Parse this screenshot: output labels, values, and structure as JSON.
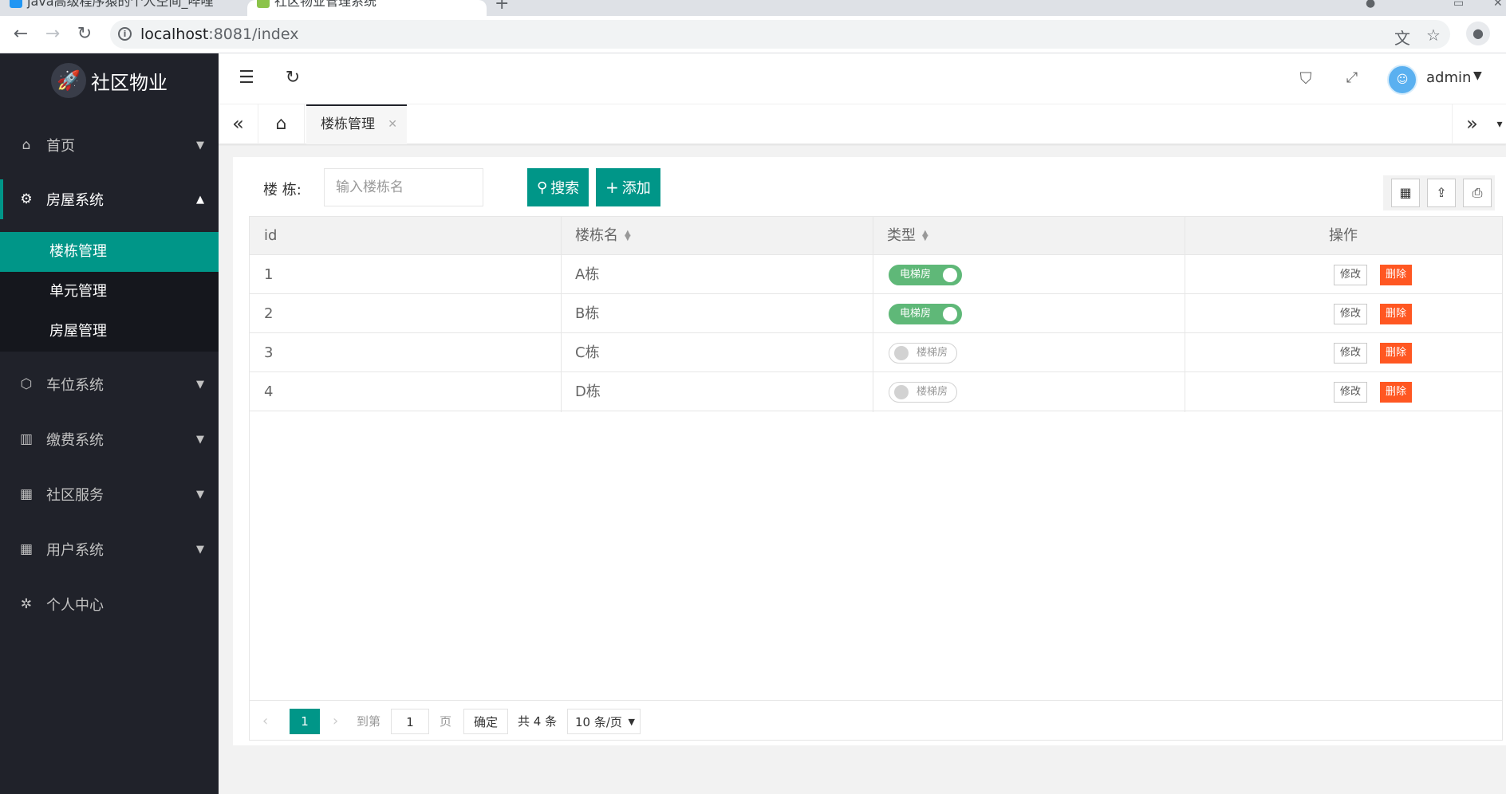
{
  "browser": {
    "tabs": [
      {
        "title": "java高级程序猿的个人空间_哔哩"
      },
      {
        "title": "社区物业管理系统"
      }
    ],
    "url_host": "localhost",
    "url_path": ":8081/index"
  },
  "sidebar": {
    "logo_text": "社区物业",
    "items": [
      {
        "label": "首页",
        "icon": "home-icon"
      },
      {
        "label": "房屋系统",
        "icon": "gear-icon"
      },
      {
        "label": "车位系统",
        "icon": "cube-icon"
      },
      {
        "label": "缴费系统",
        "icon": "building-icon"
      },
      {
        "label": "社区服务",
        "icon": "grid-icon"
      },
      {
        "label": "用户系统",
        "icon": "grid-icon"
      },
      {
        "label": "个人中心",
        "icon": "settings-icon"
      }
    ],
    "subitems": [
      {
        "label": "楼栋管理"
      },
      {
        "label": "单元管理"
      },
      {
        "label": "房屋管理"
      }
    ]
  },
  "header": {
    "username": "admin"
  },
  "tabs": {
    "active_label": "楼栋管理"
  },
  "filter": {
    "label": "楼 栋:",
    "placeholder": "输入楼栋名",
    "search_label": "搜索",
    "add_label": "添加"
  },
  "table": {
    "columns": [
      "id",
      "楼栋名",
      "类型",
      "操作"
    ],
    "rows": [
      {
        "id": "1",
        "name": "A栋",
        "type": "电梯房",
        "on": true,
        "edit": "修改",
        "del": "删除"
      },
      {
        "id": "2",
        "name": "B栋",
        "type": "电梯房",
        "on": true,
        "edit": "修改",
        "del": "删除"
      },
      {
        "id": "3",
        "name": "C栋",
        "type": "楼梯房",
        "on": false,
        "edit": "修改",
        "del": "删除"
      },
      {
        "id": "4",
        "name": "D栋",
        "type": "楼梯房",
        "on": false,
        "edit": "修改",
        "del": "删除"
      }
    ]
  },
  "pager": {
    "current": "1",
    "goto_prefix": "到第",
    "goto_value": "1",
    "goto_suffix": "页",
    "confirm": "确定",
    "total": "共 4 条",
    "page_size": "10 条/页"
  },
  "colors": {
    "accent": "#009688",
    "sidebar_bg": "#20222a",
    "switch_on": "#5fb878",
    "danger": "#ff5722"
  }
}
